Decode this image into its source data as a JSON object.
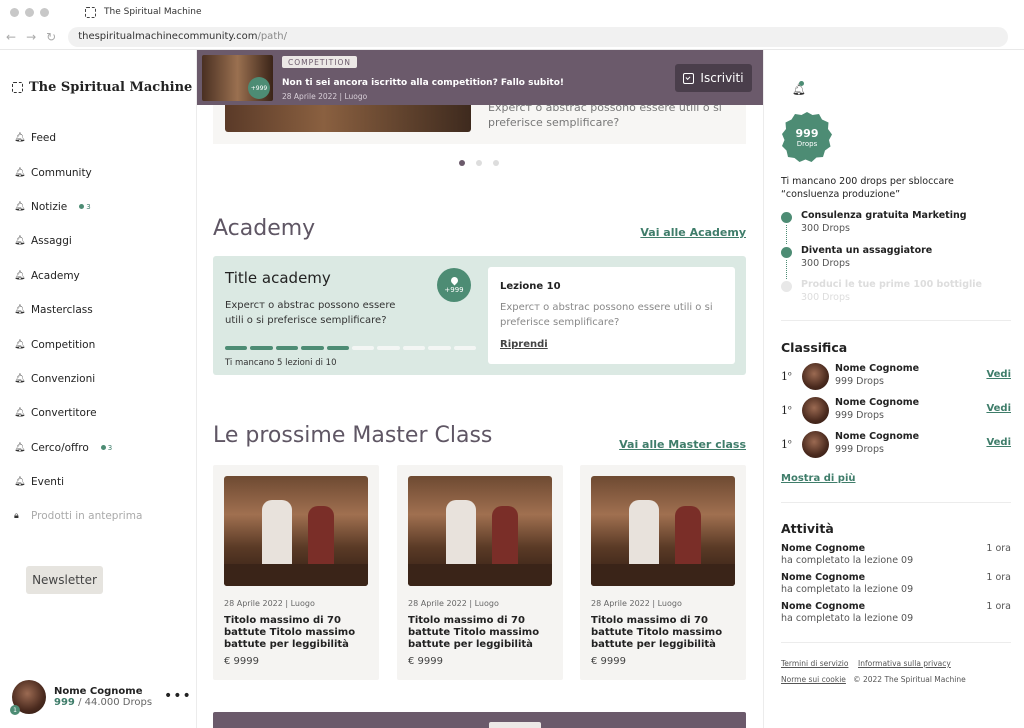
{
  "browser": {
    "tab_title": "The Spiritual Machine",
    "url_host": "thespiritualmachinecommunity.com",
    "url_path": "/path/"
  },
  "sidebar": {
    "logo": "The Spiritual Machine",
    "items": [
      {
        "label": "Feed"
      },
      {
        "label": "Community"
      },
      {
        "label": "Notizie",
        "badge": "3"
      },
      {
        "label": "Assaggi"
      },
      {
        "label": "Academy"
      },
      {
        "label": "Masterclass"
      },
      {
        "label": "Competition"
      },
      {
        "label": "Convenzioni"
      },
      {
        "label": "Convertitore"
      },
      {
        "label": "Cerco/offro",
        "badge": "3"
      },
      {
        "label": "Eventi"
      },
      {
        "label": "Prodotti in anteprima",
        "disabled": true
      }
    ],
    "newsletter": "Newsletter",
    "user": {
      "name": "Nome Cognome",
      "drops": "999",
      "total": "/ 44.000 Drops",
      "badge": "1"
    }
  },
  "banner": {
    "tag": "COMPETITION",
    "text": "Non ti sei ancora iscritto alla competition? Fallo subito!",
    "date": "28 Aprile 2022 | Luogo",
    "badge": "+999",
    "button": "Iscriviti"
  },
  "topcard": {
    "text_line1": "Expercт o abstrac possono essere utili o si",
    "text_line2": "preferisce semplificare?"
  },
  "carousel": {
    "count": 3,
    "active": 0
  },
  "academy": {
    "title": "Academy",
    "link": "Vai alle Academy",
    "card": {
      "title": "Title academy",
      "desc": "Expercт o abstrac possono essere utili o si preferisce semplificare?",
      "badge": "+999",
      "progress_done": 5,
      "progress_total": 10,
      "remaining": "Ti mancano 5 lezioni di 10"
    },
    "lesson": {
      "title": "Lezione 10",
      "desc": "Expercт o abstrac possono essere utili o si preferisce semplificare?",
      "link": "Riprendi"
    }
  },
  "masterclass": {
    "title": "Le prossime Master Class",
    "link": "Vai alle Master class",
    "cards": [
      {
        "date": "28 Aprile 2022 | Luogo",
        "title": "Titolo massimo di 70 battute Titolo massimo battute per leggibilità",
        "price": "€ 9999"
      },
      {
        "date": "28 Aprile 2022 | Luogo",
        "title": "Titolo massimo di 70 battute Titolo massimo battute per leggibilità",
        "price": "€ 9999"
      },
      {
        "date": "28 Aprile 2022 | Luogo",
        "title": "Titolo massimo di 70 battute Titolo massimo battute per leggibilità",
        "price": "€ 9999"
      }
    ]
  },
  "right": {
    "drops_value": "999",
    "drops_label": "Drops",
    "unlock_text": "Ti mancano 200 drops per sbloccare “consluenza produzione”",
    "timeline": [
      {
        "title": "Consulenza gratuita Marketing",
        "sub": "300 Drops",
        "done": true
      },
      {
        "title": "Diventa un assaggiatore",
        "sub": "300 Drops",
        "done": true
      },
      {
        "title": "Produci le tue prime 100 bottiglie",
        "sub": "300 Drops",
        "done": false
      }
    ],
    "ranking_title": "Classifica",
    "ranking": [
      {
        "pos": "1",
        "sup": "o",
        "name": "Nome Cognome",
        "drops": "999 Drops",
        "link": "Vedi"
      },
      {
        "pos": "1",
        "sup": "o",
        "name": "Nome Cognome",
        "drops": "999 Drops",
        "link": "Vedi"
      },
      {
        "pos": "1",
        "sup": "o",
        "name": "Nome Cognome",
        "drops": "999 Drops",
        "link": "Vedi"
      }
    ],
    "show_more": "Mostra di più",
    "activity_title": "Attività",
    "activity": [
      {
        "name": "Nome Cognome",
        "desc": "ha completato la lezione 09",
        "time": "1 ora"
      },
      {
        "name": "Nome Cognome",
        "desc": "ha completato la lezione 09",
        "time": "1 ora"
      },
      {
        "name": "Nome Cognome",
        "desc": "ha completato la lezione 09",
        "time": "1 ora"
      }
    ],
    "footer": {
      "terms": "Termini di servizio",
      "privacy": "Informativa sulla privacy",
      "cookie": "Norme sui cookie",
      "copyright": "© 2022 The Spiritual Machine"
    }
  },
  "colors": {
    "accent_green": "#4d8c74",
    "brand_purple": "#6b5a6b",
    "academy_bg": "#dbe9e3"
  },
  "icons": [
    "bell-icon",
    "lock-icon",
    "calendar-check-icon",
    "drop-icon",
    "back-icon",
    "forward-icon",
    "reload-icon",
    "more-icon"
  ]
}
